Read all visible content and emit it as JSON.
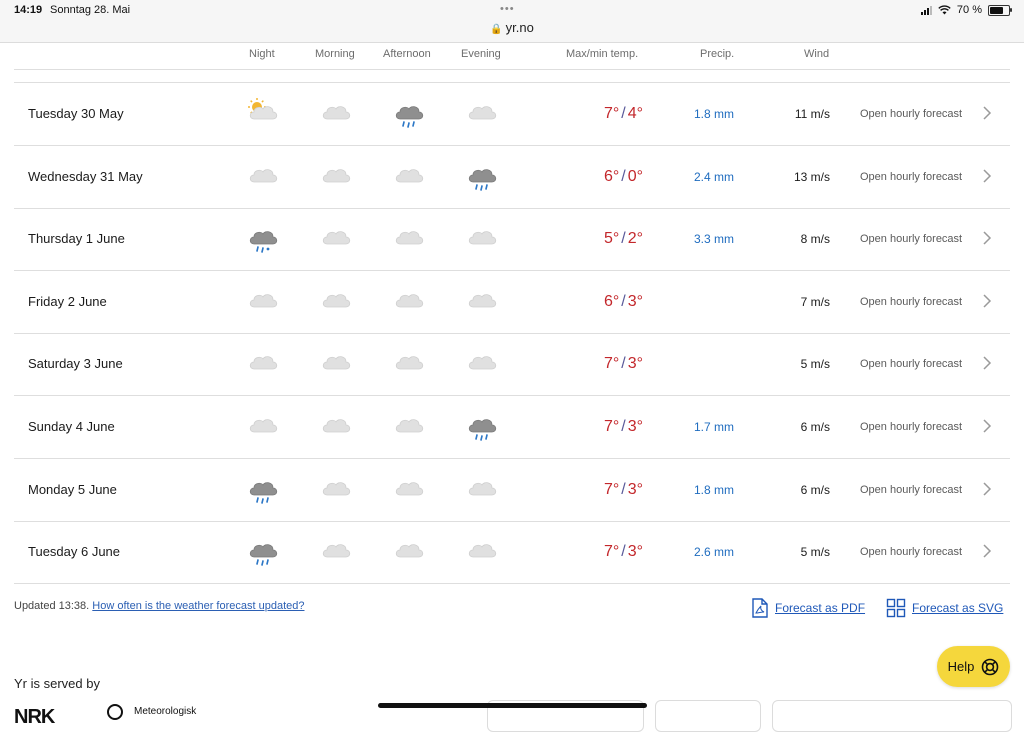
{
  "status_bar": {
    "time": "14:19",
    "date": "Sonntag 28. Mai",
    "url": "yr.no",
    "battery": "70 %",
    "battery_level": 0.7,
    "icons": [
      "signal-icon",
      "wifi-icon",
      "battery-icon",
      "lock-icon"
    ]
  },
  "table": {
    "headers": {
      "night": "Night",
      "morning": "Morning",
      "afternoon": "Afternoon",
      "evening": "Evening",
      "temp": "Max/min temp.",
      "precip": "Precip.",
      "wind": "Wind"
    },
    "rows": [
      {
        "day": "Tuesday 30 May",
        "icons": [
          "partly-cloudy-night-icon",
          "cloudy-icon",
          "rain-icon",
          "cloudy-icon"
        ],
        "max": "7°",
        "min": "4°",
        "precip": "1.8 mm",
        "wind": "11 m/s",
        "open": "Open hourly forecast"
      },
      {
        "day": "Wednesday 31 May",
        "icons": [
          "cloudy-icon",
          "cloudy-icon",
          "cloudy-icon",
          "rain-icon"
        ],
        "max": "6°",
        "min": "0°",
        "precip": "2.4 mm",
        "wind": "13 m/s",
        "open": "Open hourly forecast"
      },
      {
        "day": "Thursday 1 June",
        "icons": [
          "sleet-icon",
          "cloudy-icon",
          "cloudy-icon",
          "cloudy-icon"
        ],
        "max": "5°",
        "min": "2°",
        "precip": "3.3 mm",
        "wind": "8 m/s",
        "open": "Open hourly forecast"
      },
      {
        "day": "Friday 2 June",
        "icons": [
          "cloudy-icon",
          "cloudy-icon",
          "cloudy-icon",
          "cloudy-icon"
        ],
        "max": "6°",
        "min": "3°",
        "precip": "",
        "wind": "7 m/s",
        "open": "Open hourly forecast"
      },
      {
        "day": "Saturday 3 June",
        "icons": [
          "cloudy-icon",
          "cloudy-icon",
          "cloudy-icon",
          "cloudy-icon"
        ],
        "max": "7°",
        "min": "3°",
        "precip": "",
        "wind": "5 m/s",
        "open": "Open hourly forecast"
      },
      {
        "day": "Sunday 4 June",
        "icons": [
          "cloudy-icon",
          "cloudy-icon",
          "cloudy-icon",
          "rain-icon"
        ],
        "max": "7°",
        "min": "3°",
        "precip": "1.7 mm",
        "wind": "6 m/s",
        "open": "Open hourly forecast"
      },
      {
        "day": "Monday 5 June",
        "icons": [
          "rain-icon",
          "cloudy-icon",
          "cloudy-icon",
          "cloudy-icon"
        ],
        "max": "7°",
        "min": "3°",
        "precip": "1.8 mm",
        "wind": "6 m/s",
        "open": "Open hourly forecast"
      },
      {
        "day": "Tuesday 6 June",
        "icons": [
          "rain-icon",
          "cloudy-icon",
          "cloudy-icon",
          "cloudy-icon"
        ],
        "max": "7°",
        "min": "3°",
        "precip": "2.6 mm",
        "wind": "5 m/s",
        "open": "Open hourly forecast"
      }
    ]
  },
  "footer": {
    "updated": "Updated 13:38.",
    "updated_link": "How often is the weather forecast updated?",
    "pdf": "Forecast as PDF",
    "svg": "Forecast as SVG",
    "help": "Help",
    "served_by": "Yr is served by",
    "nrk": "NRK",
    "met": "Meteorologisk"
  },
  "colors": {
    "max_temp": "#c3272b",
    "min_temp": "#c3272b",
    "precip": "#1f6cbf",
    "link": "#1f58b8",
    "help_bg": "#f5d73c"
  }
}
